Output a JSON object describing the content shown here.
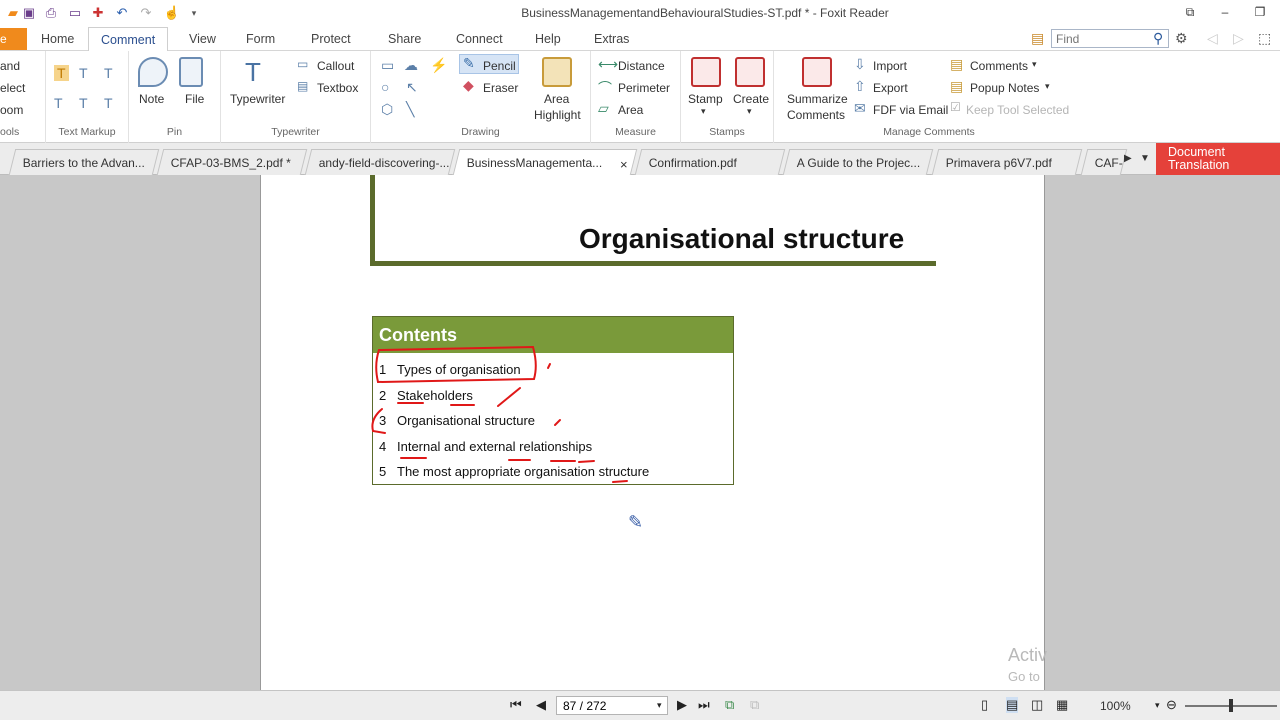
{
  "window": {
    "title": "BusinessManagementandBehaviouralStudies-ST.pdf * - Foxit Reader"
  },
  "menu": {
    "file": "e",
    "items": [
      "Home",
      "Comment",
      "View",
      "Form",
      "Protect",
      "Share",
      "Connect",
      "Help",
      "Extras"
    ],
    "active": "Comment"
  },
  "search": {
    "placeholder": "Find"
  },
  "ribbon": {
    "tools": {
      "hand": "and",
      "select": "elect",
      "zoom": "oom",
      "label": "ools"
    },
    "text_markup": {
      "label": "Text Markup"
    },
    "pin": {
      "note": "Note",
      "file": "File",
      "label": "Pin"
    },
    "typewriter": {
      "typewriter": "Typewriter",
      "callout": "Callout",
      "textbox": "Textbox",
      "label": "Typewriter"
    },
    "drawing": {
      "pencil": "Pencil",
      "eraser": "Eraser",
      "area_highlight_1": "Area",
      "area_highlight_2": "Highlight",
      "label": "Drawing"
    },
    "measure": {
      "distance": "Distance",
      "perimeter": "Perimeter",
      "area": "Area",
      "label": "Measure"
    },
    "stamps": {
      "stamp": "Stamp",
      "create": "Create",
      "label": "Stamps"
    },
    "manage": {
      "summarize_1": "Summarize",
      "summarize_2": "Comments",
      "import": "Import",
      "export": "Export",
      "fdf_email": "FDF via Email",
      "comments": "Comments",
      "popup_notes": "Popup Notes",
      "keep_tool": "Keep Tool Selected",
      "label": "Manage Comments"
    }
  },
  "tabs": [
    {
      "label": "Barriers to the Advan..."
    },
    {
      "label": "CFAP-03-BMS_2.pdf *"
    },
    {
      "label": "andy-field-discovering-..."
    },
    {
      "label": "BusinessManagementa..."
    },
    {
      "label": "Confirmation.pdf"
    },
    {
      "label": "A Guide to the Projec..."
    },
    {
      "label": "Primavera p6V7.pdf"
    },
    {
      "label": "CAF-"
    }
  ],
  "doc_translation": {
    "line1": "Document",
    "line2": "Translation"
  },
  "document": {
    "heading": "Organisational structure",
    "contents_title": "Contents",
    "contents": [
      {
        "num": "1",
        "text": "Types of organisation"
      },
      {
        "num": "2",
        "text": "Stakeholders"
      },
      {
        "num": "3",
        "text": "Organisational structure"
      },
      {
        "num": "4",
        "text": "Internal and external relationships"
      },
      {
        "num": "5",
        "text": "The most appropriate organisation structure"
      }
    ]
  },
  "status": {
    "page": "87 / 272",
    "zoom": "100%"
  },
  "watermark": {
    "line1": "Activ",
    "line2": "Go to"
  },
  "colors": {
    "file_tab": "#f08a1c",
    "contents_header": "#7a9a3a",
    "frame": "#5b6b2c",
    "doc_translation": "#e5413a",
    "annotation": "#e01818"
  }
}
